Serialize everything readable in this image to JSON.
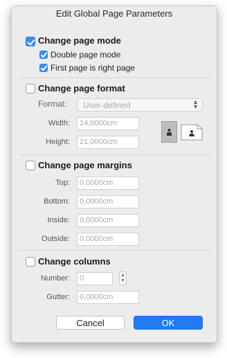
{
  "dialog": {
    "title": "Edit Global Page Parameters"
  },
  "page_mode": {
    "title": "Change page mode",
    "checked": true,
    "options": [
      {
        "label": "Double page mode",
        "checked": true
      },
      {
        "label": "First page is right page",
        "checked": true
      }
    ]
  },
  "page_format": {
    "title": "Change page format",
    "checked": false,
    "format_label": "Format:",
    "format_value": "User-defined",
    "width_label": "Width:",
    "width_value": "14,0000cm",
    "height_label": "Height:",
    "height_value": "21,0000cm",
    "icons": [
      "portrait-orientation-icon",
      "landscape-orientation-icon"
    ]
  },
  "page_margins": {
    "title": "Change page margins",
    "checked": false,
    "fields": [
      {
        "label": "Top:",
        "value": "0,0000cm"
      },
      {
        "label": "Bottom:",
        "value": "0,0000cm"
      },
      {
        "label": "Inside:",
        "value": "0,0000cm"
      },
      {
        "label": "Outside:",
        "value": "0,0000cm"
      }
    ]
  },
  "columns": {
    "title": "Change columns",
    "checked": false,
    "number_label": "Number:",
    "number_value": "0",
    "gutter_label": "Gutter:",
    "gutter_value": "0,0000cm"
  },
  "buttons": {
    "cancel": "Cancel",
    "ok": "OK"
  },
  "colors": {
    "accent": "#3b8ef5",
    "ok_button": "#1f7cf2"
  }
}
